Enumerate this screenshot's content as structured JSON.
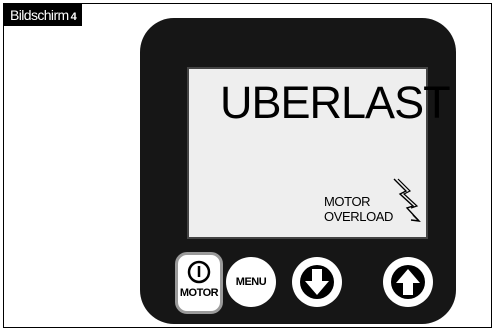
{
  "screen_label": {
    "text": "Bildschirm",
    "number": "4"
  },
  "display": {
    "title": "UBERLAST",
    "message_line1": "MOTOR",
    "message_line2": "OVERLOAD",
    "warning_icon": "lightning-bolt-icon"
  },
  "buttons": {
    "motor": {
      "label": "MOTOR",
      "icon": "power-icon"
    },
    "menu": {
      "label": "MENU"
    },
    "down": {
      "icon": "arrow-down-icon"
    },
    "up": {
      "icon": "arrow-up-icon"
    }
  },
  "colors": {
    "device_body": "#161616",
    "lcd_background": "#eeeeee"
  }
}
